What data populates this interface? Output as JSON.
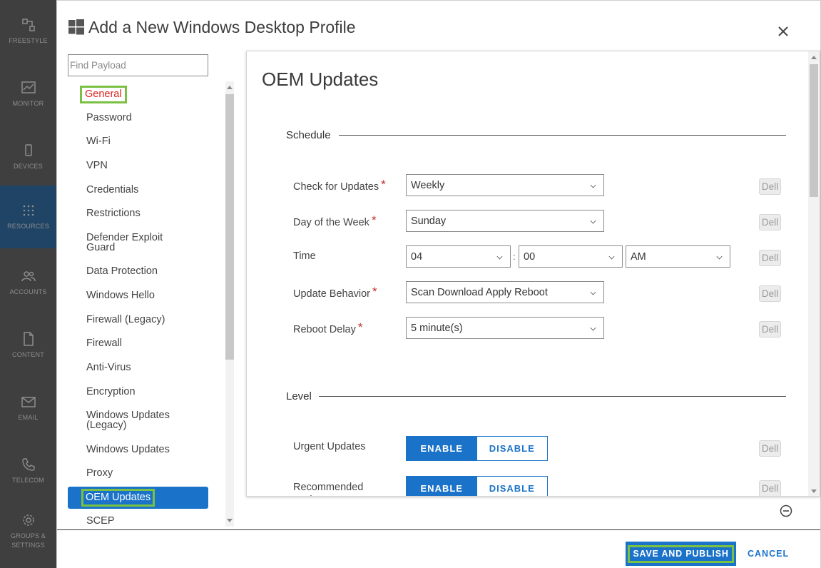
{
  "rail": {
    "items": [
      {
        "label": "FREESTYLE",
        "icon": "freestyle-icon"
      },
      {
        "label": "MONITOR",
        "icon": "monitor-icon"
      },
      {
        "label": "DEVICES",
        "icon": "devices-icon"
      },
      {
        "label": "RESOURCES",
        "icon": "resources-icon",
        "active": true
      },
      {
        "label": "ACCOUNTS",
        "icon": "accounts-icon"
      },
      {
        "label": "CONTENT",
        "icon": "content-icon"
      },
      {
        "label": "EMAIL",
        "icon": "email-icon"
      },
      {
        "label": "TELECOM",
        "icon": "telecom-icon"
      },
      {
        "label": "GROUPS & SETTINGS",
        "icon": "gear-icon"
      }
    ]
  },
  "modal": {
    "title": "Add a New Windows Desktop Profile",
    "search_placeholder": "Find Payload",
    "payloads": [
      "General",
      "Password",
      "Wi-Fi",
      "VPN",
      "Credentials",
      "Restrictions",
      "Defender Exploit Guard",
      "Data Protection",
      "Windows Hello",
      "Firewall (Legacy)",
      "Firewall",
      "Anti-Virus",
      "Encryption",
      "Windows Updates (Legacy)",
      "Windows Updates",
      "Proxy",
      "OEM Updates",
      "SCEP"
    ],
    "selected_payload": "OEM Updates"
  },
  "content": {
    "title": "OEM Updates",
    "schedule": {
      "section_title": "Schedule",
      "check_for_updates": {
        "label": "Check for Updates",
        "value": "Weekly"
      },
      "day_of_week": {
        "label": "Day of the Week",
        "value": "Sunday"
      },
      "time": {
        "label": "Time",
        "hour": "04",
        "separator": ":",
        "minute": "00",
        "ampm": "AM"
      },
      "update_behavior": {
        "label": "Update Behavior",
        "value": "Scan Download Apply Reboot"
      },
      "reboot_delay": {
        "label": "Reboot Delay",
        "value": "5 minute(s)"
      }
    },
    "level": {
      "section_title": "Level",
      "urgent": {
        "label": "Urgent Updates",
        "enable": "ENABLE",
        "disable": "DISABLE"
      },
      "recommended": {
        "label": "Recommended Updates",
        "enable": "ENABLE",
        "disable": "DISABLE"
      }
    },
    "oem_badge": "Dell",
    "required_mark": "*"
  },
  "footer": {
    "save_publish": "SAVE AND PUBLISH",
    "cancel": "CANCEL"
  },
  "colors": {
    "accent": "#1a73c9",
    "highlight": "#7ac143",
    "required": "#c0312b",
    "general_text": "#e0201b"
  }
}
